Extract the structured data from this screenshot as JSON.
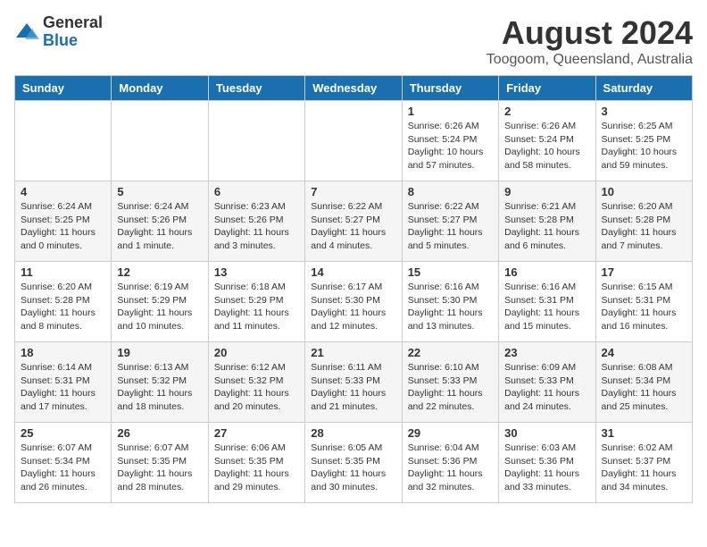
{
  "logo": {
    "general": "General",
    "blue": "Blue"
  },
  "title": "August 2024",
  "location": "Toogoom, Queensland, Australia",
  "days_of_week": [
    "Sunday",
    "Monday",
    "Tuesday",
    "Wednesday",
    "Thursday",
    "Friday",
    "Saturday"
  ],
  "weeks": [
    [
      {
        "day": "",
        "info": ""
      },
      {
        "day": "",
        "info": ""
      },
      {
        "day": "",
        "info": ""
      },
      {
        "day": "",
        "info": ""
      },
      {
        "day": "1",
        "info": "Sunrise: 6:26 AM\nSunset: 5:24 PM\nDaylight: 10 hours\nand 57 minutes."
      },
      {
        "day": "2",
        "info": "Sunrise: 6:26 AM\nSunset: 5:24 PM\nDaylight: 10 hours\nand 58 minutes."
      },
      {
        "day": "3",
        "info": "Sunrise: 6:25 AM\nSunset: 5:25 PM\nDaylight: 10 hours\nand 59 minutes."
      }
    ],
    [
      {
        "day": "4",
        "info": "Sunrise: 6:24 AM\nSunset: 5:25 PM\nDaylight: 11 hours\nand 0 minutes."
      },
      {
        "day": "5",
        "info": "Sunrise: 6:24 AM\nSunset: 5:26 PM\nDaylight: 11 hours\nand 1 minute."
      },
      {
        "day": "6",
        "info": "Sunrise: 6:23 AM\nSunset: 5:26 PM\nDaylight: 11 hours\nand 3 minutes."
      },
      {
        "day": "7",
        "info": "Sunrise: 6:22 AM\nSunset: 5:27 PM\nDaylight: 11 hours\nand 4 minutes."
      },
      {
        "day": "8",
        "info": "Sunrise: 6:22 AM\nSunset: 5:27 PM\nDaylight: 11 hours\nand 5 minutes."
      },
      {
        "day": "9",
        "info": "Sunrise: 6:21 AM\nSunset: 5:28 PM\nDaylight: 11 hours\nand 6 minutes."
      },
      {
        "day": "10",
        "info": "Sunrise: 6:20 AM\nSunset: 5:28 PM\nDaylight: 11 hours\nand 7 minutes."
      }
    ],
    [
      {
        "day": "11",
        "info": "Sunrise: 6:20 AM\nSunset: 5:28 PM\nDaylight: 11 hours\nand 8 minutes."
      },
      {
        "day": "12",
        "info": "Sunrise: 6:19 AM\nSunset: 5:29 PM\nDaylight: 11 hours\nand 10 minutes."
      },
      {
        "day": "13",
        "info": "Sunrise: 6:18 AM\nSunset: 5:29 PM\nDaylight: 11 hours\nand 11 minutes."
      },
      {
        "day": "14",
        "info": "Sunrise: 6:17 AM\nSunset: 5:30 PM\nDaylight: 11 hours\nand 12 minutes."
      },
      {
        "day": "15",
        "info": "Sunrise: 6:16 AM\nSunset: 5:30 PM\nDaylight: 11 hours\nand 13 minutes."
      },
      {
        "day": "16",
        "info": "Sunrise: 6:16 AM\nSunset: 5:31 PM\nDaylight: 11 hours\nand 15 minutes."
      },
      {
        "day": "17",
        "info": "Sunrise: 6:15 AM\nSunset: 5:31 PM\nDaylight: 11 hours\nand 16 minutes."
      }
    ],
    [
      {
        "day": "18",
        "info": "Sunrise: 6:14 AM\nSunset: 5:31 PM\nDaylight: 11 hours\nand 17 minutes."
      },
      {
        "day": "19",
        "info": "Sunrise: 6:13 AM\nSunset: 5:32 PM\nDaylight: 11 hours\nand 18 minutes."
      },
      {
        "day": "20",
        "info": "Sunrise: 6:12 AM\nSunset: 5:32 PM\nDaylight: 11 hours\nand 20 minutes."
      },
      {
        "day": "21",
        "info": "Sunrise: 6:11 AM\nSunset: 5:33 PM\nDaylight: 11 hours\nand 21 minutes."
      },
      {
        "day": "22",
        "info": "Sunrise: 6:10 AM\nSunset: 5:33 PM\nDaylight: 11 hours\nand 22 minutes."
      },
      {
        "day": "23",
        "info": "Sunrise: 6:09 AM\nSunset: 5:33 PM\nDaylight: 11 hours\nand 24 minutes."
      },
      {
        "day": "24",
        "info": "Sunrise: 6:08 AM\nSunset: 5:34 PM\nDaylight: 11 hours\nand 25 minutes."
      }
    ],
    [
      {
        "day": "25",
        "info": "Sunrise: 6:07 AM\nSunset: 5:34 PM\nDaylight: 11 hours\nand 26 minutes."
      },
      {
        "day": "26",
        "info": "Sunrise: 6:07 AM\nSunset: 5:35 PM\nDaylight: 11 hours\nand 28 minutes."
      },
      {
        "day": "27",
        "info": "Sunrise: 6:06 AM\nSunset: 5:35 PM\nDaylight: 11 hours\nand 29 minutes."
      },
      {
        "day": "28",
        "info": "Sunrise: 6:05 AM\nSunset: 5:35 PM\nDaylight: 11 hours\nand 30 minutes."
      },
      {
        "day": "29",
        "info": "Sunrise: 6:04 AM\nSunset: 5:36 PM\nDaylight: 11 hours\nand 32 minutes."
      },
      {
        "day": "30",
        "info": "Sunrise: 6:03 AM\nSunset: 5:36 PM\nDaylight: 11 hours\nand 33 minutes."
      },
      {
        "day": "31",
        "info": "Sunrise: 6:02 AM\nSunset: 5:37 PM\nDaylight: 11 hours\nand 34 minutes."
      }
    ]
  ]
}
